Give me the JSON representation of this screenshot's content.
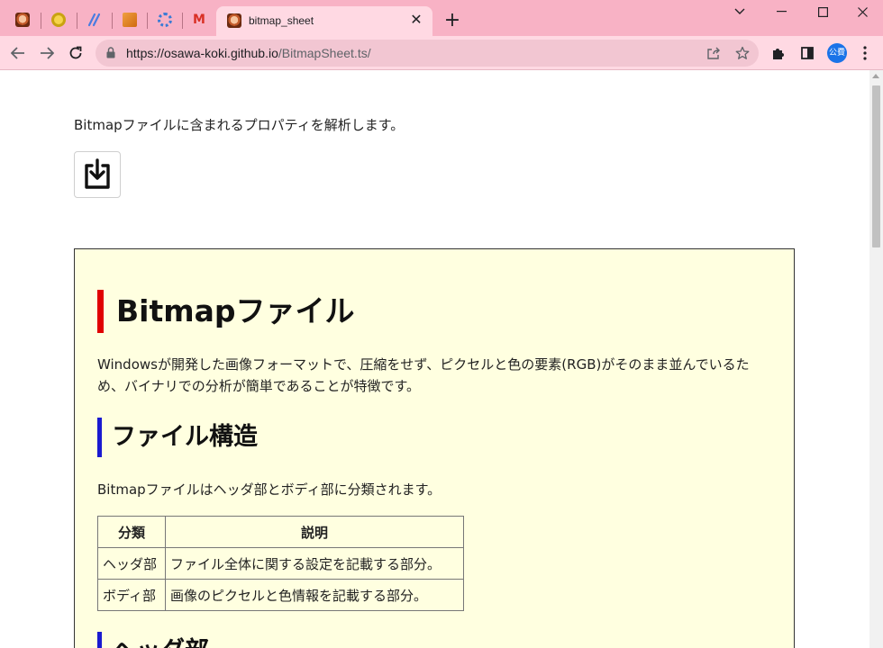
{
  "browser": {
    "pinned_tabs": [
      {
        "name": "face-favicon-icon"
      },
      {
        "name": "ring-favicon-icon"
      },
      {
        "name": "slash-favicon-icon"
      },
      {
        "name": "box-favicon-icon"
      },
      {
        "name": "gear-favicon-icon"
      },
      {
        "name": "gmail-favicon-icon",
        "glyph": "M"
      }
    ],
    "active_tab": {
      "title": "bitmap_sheet",
      "close_glyph": "✕"
    },
    "new_tab_glyph": "+",
    "window_controls": {
      "tab_search": "⌵",
      "minimize": "—",
      "maximize": "☐",
      "close": "✕"
    },
    "url_host": "https://osawa-koki.github.io",
    "url_path": "/BitmapSheet.ts/",
    "avatar_text": "公費",
    "colors": {
      "tabstrip": "#f8b2c5",
      "toolbar": "#ffd9e3",
      "omnibox": "#f2c6d2"
    }
  },
  "page": {
    "intro": "Bitmapファイルに含まれるプロパティを解析します。",
    "download_icon": "download-tray-icon",
    "sheet": {
      "title": "Bitmapファイル",
      "description": "Windowsが開発した画像フォーマットで、圧縮をせず、ピクセルと色の要素(RGB)がそのまま並んでいるため、バイナリでの分析が簡単であることが特徴です。",
      "structure_heading": "ファイル構造",
      "structure_text": "Bitmapファイルはヘッダ部とボディ部に分類されます。",
      "table": {
        "headers": [
          "分類",
          "説明"
        ],
        "rows": [
          [
            "ヘッダ部",
            "ファイル全体に関する設定を記載する部分。"
          ],
          [
            "ボディ部",
            "画像のピクセルと色情報を記載する部分。"
          ]
        ]
      },
      "next_heading": "ヘッダ部",
      "colors": {
        "background": "#ffffe0",
        "h1_bar": "#e00000",
        "h2_bar": "#1a1ad0"
      }
    }
  }
}
